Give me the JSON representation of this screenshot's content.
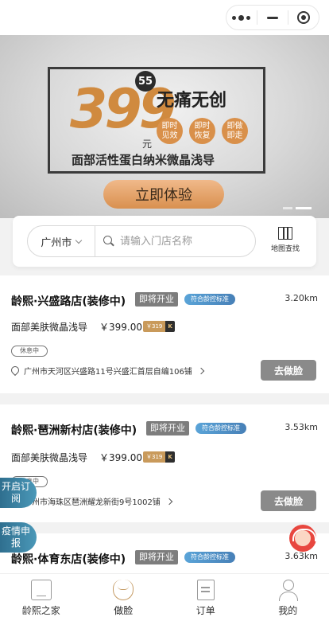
{
  "banner": {
    "price": "399",
    "badge": "55",
    "yuan": "元",
    "headline": "无痛无创",
    "pills": [
      "即时见效",
      "即时恢复",
      "即做即走"
    ],
    "subtitle": "面部活性蛋白纳米微晶浅导",
    "cta": "立即体验"
  },
  "search": {
    "city": "广州市",
    "placeholder": "请输入门店名称",
    "map_label": "地图查找"
  },
  "stores": [
    {
      "name": "龄熙·兴盛路店(装修中)",
      "tag_soon": "即将开业",
      "tag_std": "符合龄控标准",
      "distance": "3.20km",
      "service": "面部美肤微晶浅导",
      "price": "￥399.00",
      "coupon_a": "￥319",
      "coupon_b": "K",
      "status": "休息中",
      "address": "广州市天河区兴盛路11号兴盛汇首层自编106铺",
      "go": "去做脸"
    },
    {
      "name": "龄熙·琶洲新村店(装修中)",
      "tag_soon": "即将开业",
      "tag_std": "符合龄控标准",
      "distance": "3.53km",
      "service": "面部美肤微晶浅导",
      "price": "￥399.00",
      "coupon_a": "￥319",
      "coupon_b": "K",
      "status": "休息中",
      "address": "广州市海珠区琶洲耀龙新街9号1002铺",
      "go": "去做脸"
    },
    {
      "name": "龄熙·体育东店(装修中)",
      "tag_soon": "即将开业",
      "tag_std": "符合龄控标准",
      "distance": "3.63km"
    }
  ],
  "floating": {
    "subscribe": "开启订阅",
    "epidemic": "疫情申报"
  },
  "nav": [
    {
      "label": "龄熙之家",
      "icon": "home-icon"
    },
    {
      "label": "做脸",
      "icon": "face-icon"
    },
    {
      "label": "订单",
      "icon": "order-icon"
    },
    {
      "label": "我的",
      "icon": "user-icon"
    }
  ]
}
